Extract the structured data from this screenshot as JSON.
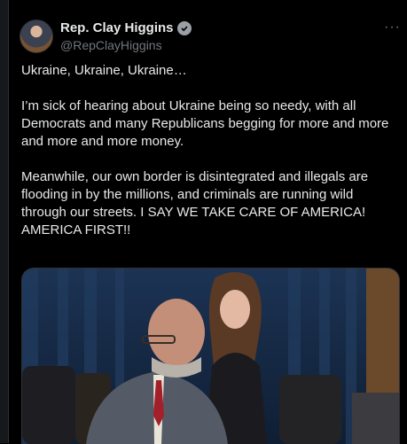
{
  "author": {
    "display_name": "Rep. Clay Higgins",
    "handle": "@RepClayHiggins",
    "verified_icon": "verified-badge-icon",
    "more_icon": "more-options-icon",
    "more_glyph": "···"
  },
  "tweet": {
    "paragraphs": [
      "Ukraine, Ukraine, Ukraine…",
      "I’m sick of hearing about Ukraine being so needy, with all Democrats and many Republicans begging for more and more and more and more money.",
      "Meanwhile, our own border is disintegrated and illegals are flooding in by the millions, and criminals are running wild through our streets. I SAY WE TAKE CARE OF AMERICA! AMERICA FIRST!!"
    ]
  },
  "colors": {
    "background": "#000000",
    "text": "#e7e9ea",
    "secondary": "#71767b"
  }
}
